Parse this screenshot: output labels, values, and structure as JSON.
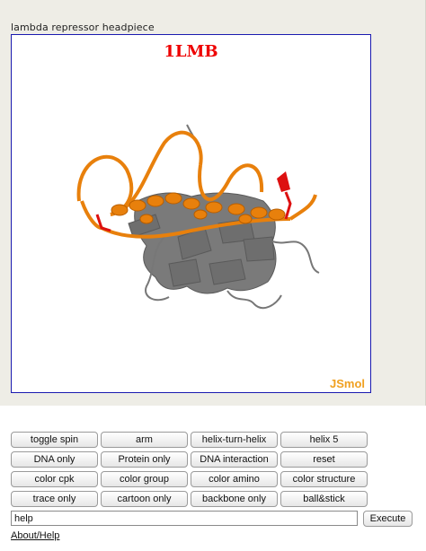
{
  "frame": {
    "title": "lambda repressor headpiece"
  },
  "viewer": {
    "pdb_id": "1LMB",
    "logo": "JSmol",
    "colors": {
      "dna": "#e8800c",
      "dna_ends": "#dd1010",
      "protein": "#6e6e6e",
      "label": "#ee0000",
      "logo": "#f0a020"
    }
  },
  "buttons": {
    "row1": [
      "toggle spin",
      "arm",
      "helix-turn-helix",
      "helix 5"
    ],
    "row2": [
      "DNA only",
      "Protein only",
      "DNA interaction",
      "reset"
    ],
    "row3": [
      "color cpk",
      "color group",
      "color amino",
      "color structure"
    ],
    "row4": [
      "trace only",
      "cartoon only",
      "backbone only",
      "ball&stick"
    ]
  },
  "command": {
    "value": "help",
    "execute_label": "Execute"
  },
  "about_link": "About/Help"
}
